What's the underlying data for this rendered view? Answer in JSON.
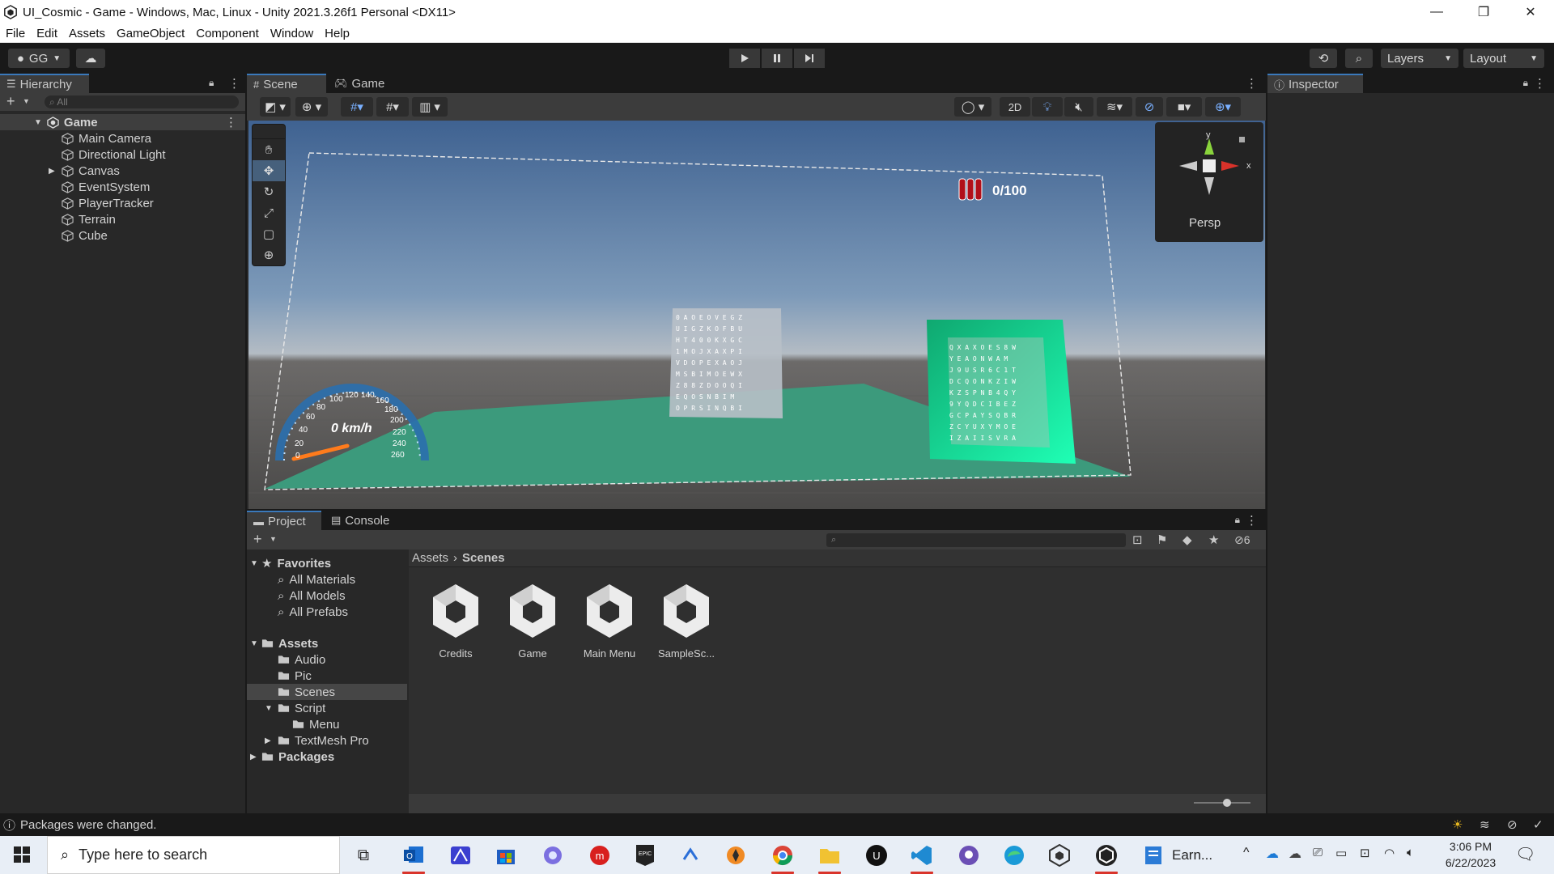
{
  "window": {
    "title": "UI_Cosmic - Game - Windows, Mac, Linux - Unity 2021.3.26f1 Personal <DX11>",
    "min_label": "—",
    "max_label": "❐",
    "close_label": "✕"
  },
  "menu": [
    "File",
    "Edit",
    "Assets",
    "GameObject",
    "Component",
    "Window",
    "Help"
  ],
  "toolbar": {
    "account_label": "GG",
    "layers_label": "Layers",
    "layout_label": "Layout"
  },
  "hierarchy": {
    "tab_label": "Hierarchy",
    "search_placeholder": "All",
    "scene_name": "Game",
    "items": [
      "Main Camera",
      "Directional Light",
      "Canvas",
      "EventSystem",
      "PlayerTracker",
      "Terrain",
      "Cube"
    ]
  },
  "scene": {
    "tabs": [
      "Scene",
      "Game"
    ],
    "mode_2d": "2D",
    "persp_label": "Persp",
    "gizmo_x": "x",
    "gizmo_y": "y",
    "counter_text": "0/100",
    "speed_text": "0 km/h",
    "speed_ticks": [
      "0",
      "20",
      "40",
      "60",
      "80",
      "100",
      "120",
      "140",
      "160",
      "180",
      "200",
      "220",
      "240",
      "260"
    ],
    "colors": {
      "sky_top": "#3e5f8a",
      "ground": "#3a9a7a",
      "accent": "#3a79bb"
    }
  },
  "inspector": {
    "tab_label": "Inspector"
  },
  "project": {
    "tabs": [
      "Project",
      "Console"
    ],
    "hidden_count": "6",
    "favorites_label": "Favorites",
    "favorites": [
      "All Materials",
      "All Models",
      "All Prefabs"
    ],
    "assets_label": "Assets",
    "asset_folders": [
      "Audio",
      "Pic",
      "Scenes",
      "Script"
    ],
    "script_children": [
      "Menu"
    ],
    "textmesh_label": "TextMesh Pro",
    "packages_label": "Packages",
    "breadcrumb": [
      "Assets",
      "Scenes"
    ],
    "scene_assets": [
      "Credits",
      "Game",
      "Main Menu",
      "SampleSc..."
    ]
  },
  "status": {
    "message": "Packages were changed."
  },
  "taskbar": {
    "search_placeholder": "Type here to search",
    "earn_label": "Earn...",
    "time": "3:06 PM",
    "date": "6/22/2023"
  }
}
